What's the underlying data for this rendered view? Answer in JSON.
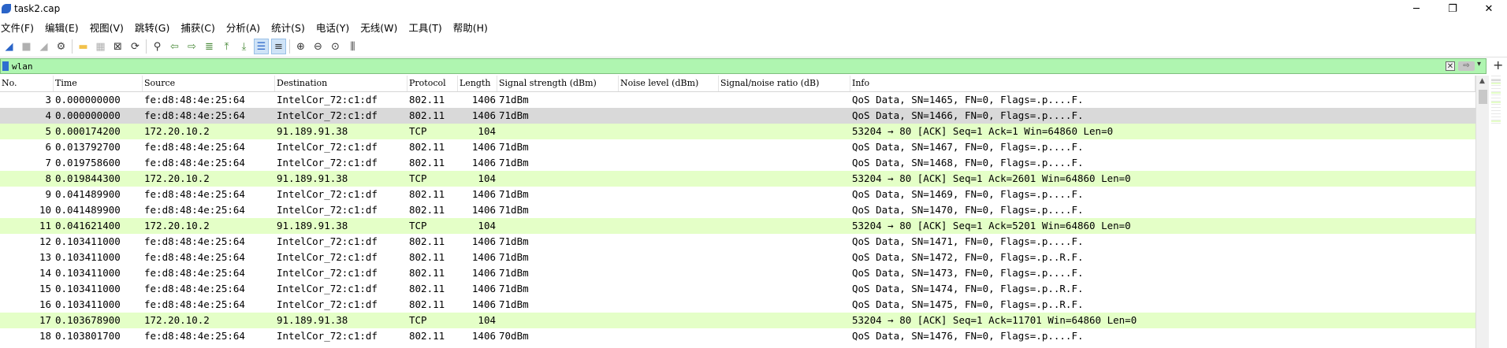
{
  "window": {
    "title": "task2.cap",
    "controls": {
      "minimize": "─",
      "maximize": "❐",
      "close": "✕"
    }
  },
  "menu": [
    "文件(F)",
    "编辑(E)",
    "视图(V)",
    "跳转(G)",
    "捕获(C)",
    "分析(A)",
    "统计(S)",
    "电话(Y)",
    "无线(W)",
    "工具(T)",
    "帮助(H)"
  ],
  "toolbar": {
    "buttons": [
      {
        "name": "shark-fin-start-icon",
        "glyph": "◢",
        "color": "#2a64c8"
      },
      {
        "name": "stop-capture-icon",
        "glyph": "■",
        "color": "#b0b0b0",
        "disabled": true
      },
      {
        "name": "restart-capture-icon",
        "glyph": "◢",
        "color": "#b0b0b0",
        "disabled": true
      },
      {
        "name": "capture-options-icon",
        "glyph": "⚙",
        "color": "#444"
      },
      {
        "name": "open-file-icon",
        "glyph": "▬",
        "color": "#f2c24b"
      },
      {
        "name": "save-file-icon",
        "glyph": "▦",
        "color": "#b0b0b0",
        "disabled": true
      },
      {
        "name": "close-file-icon",
        "glyph": "⊠",
        "color": "#333"
      },
      {
        "name": "reload-file-icon",
        "glyph": "⟳",
        "color": "#333"
      },
      {
        "name": "find-packet-icon",
        "glyph": "⚲",
        "color": "#333"
      },
      {
        "name": "go-back-icon",
        "glyph": "⇦",
        "color": "#4a8a3a"
      },
      {
        "name": "go-forward-icon",
        "glyph": "⇨",
        "color": "#4a8a3a"
      },
      {
        "name": "go-to-packet-icon",
        "glyph": "≣",
        "color": "#4a8a3a"
      },
      {
        "name": "first-packet-icon",
        "glyph": "⤒",
        "color": "#4a8a3a"
      },
      {
        "name": "last-packet-icon",
        "glyph": "⤓",
        "color": "#4a8a3a"
      },
      {
        "name": "auto-scroll-icon",
        "glyph": "☰",
        "color": "#2a64c8",
        "active": true
      },
      {
        "name": "colorize-icon",
        "glyph": "≡",
        "color": "#333",
        "active": true
      },
      {
        "name": "zoom-in-icon",
        "glyph": "⊕",
        "color": "#333"
      },
      {
        "name": "zoom-out-icon",
        "glyph": "⊖",
        "color": "#333"
      },
      {
        "name": "normal-size-icon",
        "glyph": "⊙",
        "color": "#333"
      },
      {
        "name": "resize-columns-icon",
        "glyph": "⫼",
        "color": "#333"
      }
    ]
  },
  "filter": {
    "value": "wlan",
    "clear_glyph": "✕",
    "apply_glyph": "⇨",
    "dropdown_glyph": "▾",
    "add_glyph": "+"
  },
  "columns": [
    "No.",
    "Time",
    "Source",
    "Destination",
    "Protocol",
    "Length",
    "Signal strength (dBm)",
    "Noise level (dBm)",
    "Signal/noise ratio (dB)",
    "Info"
  ],
  "packets": [
    {
      "no": "3",
      "time": "0.000000000",
      "src": "fe:d8:48:4e:25:64",
      "dst": "IntelCor_72:c1:df",
      "proto": "802.11",
      "len": "1406",
      "sig": "71dBm",
      "noise": "",
      "snr": "",
      "info": "QoS Data, SN=1465, FN=0, Flags=.p....F.",
      "kind": "wlan"
    },
    {
      "no": "4",
      "time": "0.000000000",
      "src": "fe:d8:48:4e:25:64",
      "dst": "IntelCor_72:c1:df",
      "proto": "802.11",
      "len": "1406",
      "sig": "71dBm",
      "noise": "",
      "snr": "",
      "info": "QoS Data, SN=1466, FN=0, Flags=.p....F.",
      "kind": "selected"
    },
    {
      "no": "5",
      "time": "0.000174200",
      "src": "172.20.10.2",
      "dst": "91.189.91.38",
      "proto": "TCP",
      "len": "104",
      "sig": "",
      "noise": "",
      "snr": "",
      "info": "53204 → 80 [ACK] Seq=1 Ack=1 Win=64860 Len=0",
      "kind": "tcp"
    },
    {
      "no": "6",
      "time": "0.013792700",
      "src": "fe:d8:48:4e:25:64",
      "dst": "IntelCor_72:c1:df",
      "proto": "802.11",
      "len": "1406",
      "sig": "71dBm",
      "noise": "",
      "snr": "",
      "info": "QoS Data, SN=1467, FN=0, Flags=.p....F.",
      "kind": "wlan"
    },
    {
      "no": "7",
      "time": "0.019758600",
      "src": "fe:d8:48:4e:25:64",
      "dst": "IntelCor_72:c1:df",
      "proto": "802.11",
      "len": "1406",
      "sig": "71dBm",
      "noise": "",
      "snr": "",
      "info": "QoS Data, SN=1468, FN=0, Flags=.p....F.",
      "kind": "wlan"
    },
    {
      "no": "8",
      "time": "0.019844300",
      "src": "172.20.10.2",
      "dst": "91.189.91.38",
      "proto": "TCP",
      "len": "104",
      "sig": "",
      "noise": "",
      "snr": "",
      "info": "53204 → 80 [ACK] Seq=1 Ack=2601 Win=64860 Len=0",
      "kind": "tcp"
    },
    {
      "no": "9",
      "time": "0.041489900",
      "src": "fe:d8:48:4e:25:64",
      "dst": "IntelCor_72:c1:df",
      "proto": "802.11",
      "len": "1406",
      "sig": "71dBm",
      "noise": "",
      "snr": "",
      "info": "QoS Data, SN=1469, FN=0, Flags=.p....F.",
      "kind": "wlan"
    },
    {
      "no": "10",
      "time": "0.041489900",
      "src": "fe:d8:48:4e:25:64",
      "dst": "IntelCor_72:c1:df",
      "proto": "802.11",
      "len": "1406",
      "sig": "71dBm",
      "noise": "",
      "snr": "",
      "info": "QoS Data, SN=1470, FN=0, Flags=.p....F.",
      "kind": "wlan"
    },
    {
      "no": "11",
      "time": "0.041621400",
      "src": "172.20.10.2",
      "dst": "91.189.91.38",
      "proto": "TCP",
      "len": "104",
      "sig": "",
      "noise": "",
      "snr": "",
      "info": "53204 → 80 [ACK] Seq=1 Ack=5201 Win=64860 Len=0",
      "kind": "tcp"
    },
    {
      "no": "12",
      "time": "0.103411000",
      "src": "fe:d8:48:4e:25:64",
      "dst": "IntelCor_72:c1:df",
      "proto": "802.11",
      "len": "1406",
      "sig": "71dBm",
      "noise": "",
      "snr": "",
      "info": "QoS Data, SN=1471, FN=0, Flags=.p....F.",
      "kind": "wlan"
    },
    {
      "no": "13",
      "time": "0.103411000",
      "src": "fe:d8:48:4e:25:64",
      "dst": "IntelCor_72:c1:df",
      "proto": "802.11",
      "len": "1406",
      "sig": "71dBm",
      "noise": "",
      "snr": "",
      "info": "QoS Data, SN=1472, FN=0, Flags=.p..R.F.",
      "kind": "wlan"
    },
    {
      "no": "14",
      "time": "0.103411000",
      "src": "fe:d8:48:4e:25:64",
      "dst": "IntelCor_72:c1:df",
      "proto": "802.11",
      "len": "1406",
      "sig": "71dBm",
      "noise": "",
      "snr": "",
      "info": "QoS Data, SN=1473, FN=0, Flags=.p....F.",
      "kind": "wlan"
    },
    {
      "no": "15",
      "time": "0.103411000",
      "src": "fe:d8:48:4e:25:64",
      "dst": "IntelCor_72:c1:df",
      "proto": "802.11",
      "len": "1406",
      "sig": "71dBm",
      "noise": "",
      "snr": "",
      "info": "QoS Data, SN=1474, FN=0, Flags=.p..R.F.",
      "kind": "wlan"
    },
    {
      "no": "16",
      "time": "0.103411000",
      "src": "fe:d8:48:4e:25:64",
      "dst": "IntelCor_72:c1:df",
      "proto": "802.11",
      "len": "1406",
      "sig": "71dBm",
      "noise": "",
      "snr": "",
      "info": "QoS Data, SN=1475, FN=0, Flags=.p..R.F.",
      "kind": "wlan"
    },
    {
      "no": "17",
      "time": "0.103678900",
      "src": "172.20.10.2",
      "dst": "91.189.91.38",
      "proto": "TCP",
      "len": "104",
      "sig": "",
      "noise": "",
      "snr": "",
      "info": "53204 → 80 [ACK] Seq=1 Ack=11701 Win=64860 Len=0",
      "kind": "tcp"
    },
    {
      "no": "18",
      "time": "0.103801700",
      "src": "fe:d8:48:4e:25:64",
      "dst": "IntelCor_72:c1:df",
      "proto": "802.11",
      "len": "1406",
      "sig": "70dBm",
      "noise": "",
      "snr": "",
      "info": "QoS Data, SN=1476, FN=0, Flags=.p....F.",
      "kind": "wlan"
    }
  ],
  "colors": {
    "tcp_row": "#e4ffc7",
    "selected_row": "#d9d9d9",
    "filter_valid": "#aff5b0"
  }
}
